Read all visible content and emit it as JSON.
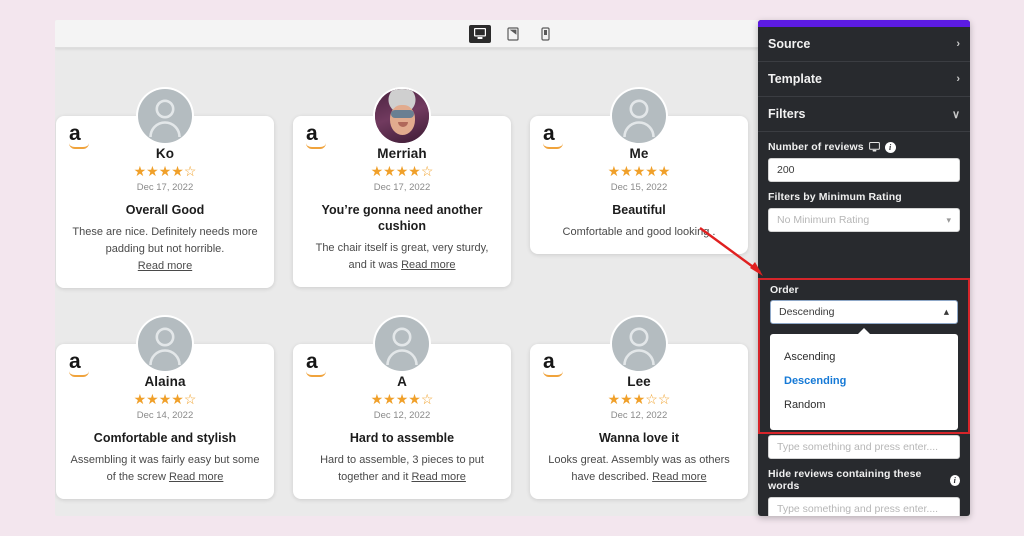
{
  "toolbar": {
    "devices": [
      {
        "name": "desktop",
        "label": "Desktop",
        "active": true
      },
      {
        "name": "tablet",
        "label": "Tablet",
        "active": false
      },
      {
        "name": "mobile",
        "label": "Mobile",
        "active": false
      }
    ]
  },
  "reviews": [
    {
      "source": "amazon",
      "avatar": "placeholder",
      "name": "Ko",
      "rating": 4,
      "stars_total": 5,
      "date": "Dec 17, 2022",
      "title": "Overall Good",
      "body": "These are nice. Definitely needs more padding but not horrible.",
      "read_more": "Read more",
      "read_more_inline": false
    },
    {
      "source": "amazon",
      "avatar": "photo",
      "name": "Merriah",
      "rating": 4,
      "stars_total": 5,
      "date": "Dec 17, 2022",
      "title": "You’re gonna need another cushion",
      "body": "The chair itself is great, very sturdy, and it was",
      "read_more": "Read more",
      "read_more_inline": true
    },
    {
      "source": "amazon",
      "avatar": "placeholder",
      "name": "Me",
      "rating": 5,
      "stars_total": 5,
      "date": "Dec 15, 2022",
      "title": "Beautiful",
      "body": "Comfortable and good looking .",
      "read_more": "",
      "read_more_inline": false
    },
    {
      "source": "amazon",
      "avatar": "placeholder",
      "name": "Alaina",
      "rating": 4,
      "stars_total": 5,
      "date": "Dec 14, 2022",
      "title": "Comfortable and stylish",
      "body": "Assembling it was fairly easy but some of the screw",
      "read_more": "Read more",
      "read_more_inline": true
    },
    {
      "source": "amazon",
      "avatar": "placeholder",
      "name": "A",
      "rating": 4,
      "stars_total": 5,
      "date": "Dec 12, 2022",
      "title": "Hard to assemble",
      "body": "Hard to assemble, 3 pieces to put together and it",
      "read_more": "Read more",
      "read_more_inline": true
    },
    {
      "source": "amazon",
      "avatar": "placeholder",
      "name": "Lee",
      "rating": 3,
      "stars_total": 5,
      "date": "Dec 12, 2022",
      "title": "Wanna love it",
      "body": "Looks great. Assembly was as others have described.",
      "read_more": "Read more",
      "read_more_inline": true
    }
  ],
  "panel": {
    "accordions": [
      {
        "label": "Source",
        "chevron": "›"
      },
      {
        "label": "Template",
        "chevron": "›"
      },
      {
        "label": "Filters",
        "chevron": "∨"
      }
    ],
    "number_of_reviews": {
      "label": "Number of reviews",
      "value": "200"
    },
    "min_rating": {
      "label": "Filters by Minimum Rating",
      "value": "No Minimum Rating"
    },
    "order": {
      "label": "Order",
      "value": "Descending",
      "options": [
        "Ascending",
        "Descending",
        "Random"
      ],
      "selected": "Descending"
    },
    "keyword_input": {
      "placeholder": "Type something and press enter...."
    },
    "hide_words": {
      "label": "Hide reviews containing these words",
      "placeholder": "Type something and press enter...."
    },
    "colors": {
      "accent_purple": "#5c1be3",
      "highlight_red": "#d6252a",
      "selected_blue": "#1579d6",
      "panel_bg": "#282a2e",
      "star_gold": "#f0a02a"
    }
  }
}
